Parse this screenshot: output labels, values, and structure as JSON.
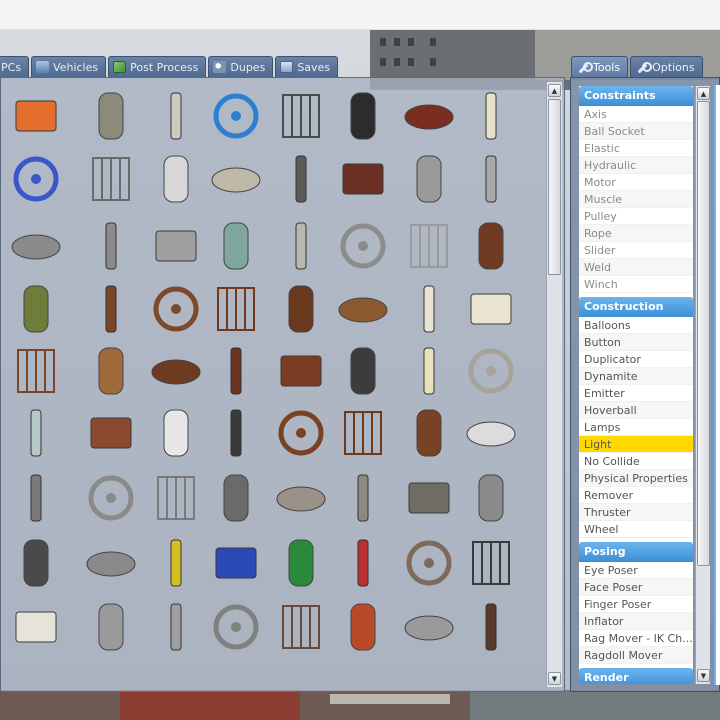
{
  "colors": {
    "tab_bg": "#5f7ca6",
    "category_header": "#3b8fd6",
    "selected_item": "#ffd800",
    "panel_bg": "#a8b1c0"
  },
  "spawnmenu": {
    "tabs": [
      {
        "label": "PCs",
        "icon": "npc-icon"
      },
      {
        "label": "Vehicles",
        "icon": "car-icon"
      },
      {
        "label": "Post Process",
        "icon": "post-process-icon"
      },
      {
        "label": "Dupes",
        "icon": "dupes-icon"
      },
      {
        "label": "Saves",
        "icon": "saves-icon"
      }
    ],
    "right_tabs": [
      {
        "label": "Tools",
        "icon": "wrench-icon"
      },
      {
        "label": "Options",
        "icon": "wrench-icon"
      }
    ]
  },
  "props": [
    "spool-prop",
    "wheel-prop",
    "panel-prop",
    "blue-barrel-prop",
    "cage-door-prop",
    "fire-extinguisher-prop",
    "gas-canister-prop",
    "propane-tank-prop",
    "blue-chair-prop",
    "lamp-post-prop",
    "sign-prop",
    "crate-prop",
    "door-prop",
    "red-door-prop",
    "fence-panel-prop",
    "fence-panel-2-prop",
    "small-fence-prop",
    "fence-prop",
    "fence-section-prop",
    "fountain-prop",
    "bathtub-prop",
    "bed-frame-prop",
    "water-heater-prop",
    "wood-chair-prop",
    "couch-prop",
    "dresser-prop",
    "dresser-2-prop",
    "drawer-prop",
    "drawer-2-prop",
    "board-prop",
    "mattress-prop",
    "mattress-2-prop",
    "table-prop",
    "plank-prop",
    "desk-prop",
    "cabinet-prop",
    "nightstand-prop",
    "stove-prop",
    "fridge-prop",
    "radiator-prop",
    "glass-shelf-prop",
    "bench-prop",
    "sink-prop",
    "kitchen-stove-prop",
    "round-table-prop",
    "table-2-prop",
    "table-3-prop",
    "toilet-prop",
    "pipe-prop",
    "grate-prop",
    "grate-2-prop",
    "post-prop",
    "gravestone-prop",
    "gravestone-2-prop",
    "tombstone-prop",
    "mailbox-prop",
    "lamp-prop",
    "cage-grey-prop",
    "cage-yellow-prop",
    "cage-blue-prop",
    "cage-green-prop",
    "cage-red-prop",
    "monument-prop",
    "street-light-prop",
    "lockers-prop",
    "bar-prop",
    "bar-2-prop",
    "hooks-prop",
    "barrel-prop",
    "rust-barrel-prop",
    "hook-prop",
    "tire-prop"
  ],
  "tools": {
    "categories": [
      {
        "name": "Constraints",
        "items": [
          "Axis",
          "Ball Socket",
          "Elastic",
          "Hydraulic",
          "Motor",
          "Muscle",
          "Pulley",
          "Rope",
          "Slider",
          "Weld",
          "Winch"
        ]
      },
      {
        "name": "Construction",
        "items": [
          "Balloons",
          "Button",
          "Duplicator",
          "Dynamite",
          "Emitter",
          "Hoverball",
          "Lamps",
          "Light",
          "No Collide",
          "Physical Properties",
          "Remover",
          "Thruster",
          "Wheel"
        ]
      },
      {
        "name": "Posing",
        "items": [
          "Eye Poser",
          "Face Poser",
          "Finger Poser",
          "Inflator",
          "Rag Mover - IK Ch...",
          "Ragdoll Mover"
        ]
      },
      {
        "name": "Render",
        "items": []
      }
    ],
    "selected": "Light"
  }
}
